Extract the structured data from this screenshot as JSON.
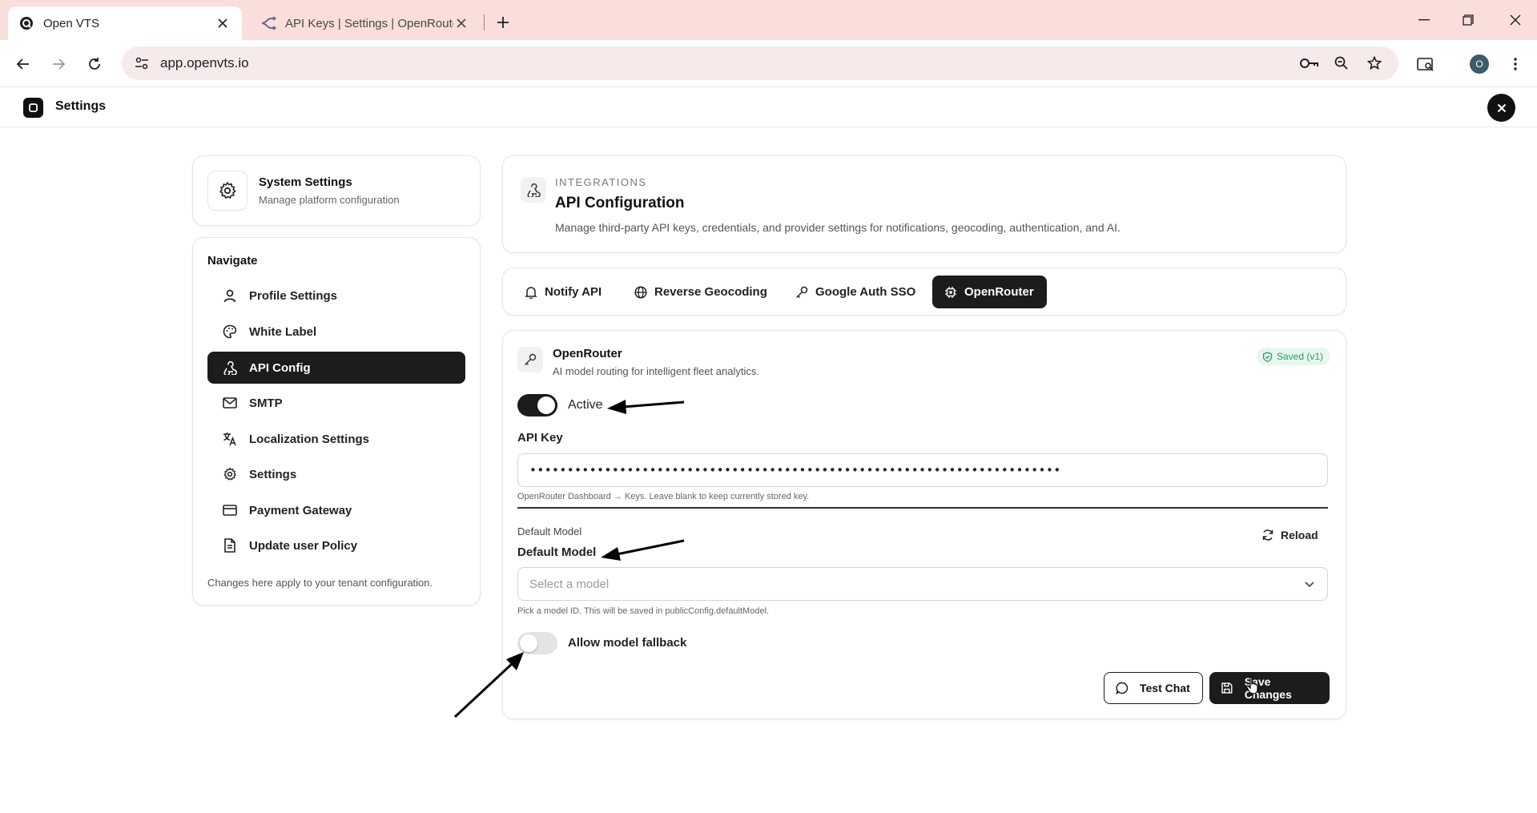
{
  "browser": {
    "tabs": [
      {
        "title": "Open VTS",
        "active": true,
        "icon": "openvts-favicon-icon"
      },
      {
        "title": "API Keys | Settings | OpenRoute",
        "active": false,
        "icon": "openrouter-favicon-icon"
      }
    ],
    "url": "app.openvts.io",
    "profile_initial": "O"
  },
  "app": {
    "title": "Settings"
  },
  "sidebar": {
    "system_title": "System Settings",
    "system_subtitle": "Manage platform configuration",
    "nav_heading": "Navigate",
    "items": [
      {
        "label": "Profile Settings",
        "icon": "user-icon",
        "active": false
      },
      {
        "label": "White Label",
        "icon": "palette-icon",
        "active": false
      },
      {
        "label": "API Config",
        "icon": "webhook-icon",
        "active": true
      },
      {
        "label": "SMTP",
        "icon": "mail-icon",
        "active": false
      },
      {
        "label": "Localization Settings",
        "icon": "languages-icon",
        "active": false
      },
      {
        "label": "Settings",
        "icon": "gear-icon",
        "active": false
      },
      {
        "label": "Payment Gateway",
        "icon": "credit-card-icon",
        "active": false
      },
      {
        "label": "Update user Policy",
        "icon": "document-icon",
        "active": false
      }
    ],
    "footer_note": "Changes here apply to your tenant configuration."
  },
  "integrations": {
    "kicker": "INTEGRATIONS",
    "title": "API Configuration",
    "description": "Manage third-party API keys, credentials, and provider settings for notifications, geocoding, authentication, and AI."
  },
  "api_tabs": [
    {
      "label": "Notify API",
      "icon": "bell-icon",
      "active": false
    },
    {
      "label": "Reverse Geocoding",
      "icon": "globe-icon",
      "active": false
    },
    {
      "label": "Google Auth SSO",
      "icon": "key-icon",
      "active": false
    },
    {
      "label": "OpenRouter",
      "icon": "cpu-icon",
      "active": true
    }
  ],
  "openrouter": {
    "title": "OpenRouter",
    "subtitle": "AI model routing for intelligent fleet analytics.",
    "badge": "Saved (v1)",
    "active_label": "Active",
    "active_on": true,
    "api_key_label": "API Key",
    "api_key_value": "•••••••••••••••••••••••••••••••••••••••••••••••••••••••••••••••••••••••",
    "api_key_hint": "OpenRouter Dashboard → Keys. Leave blank to keep currently stored key.",
    "default_model_small": "Default Model",
    "reload_label": "Reload",
    "default_model_label": "Default Model",
    "model_placeholder": "Select a model",
    "model_hint": "Pick a model ID. This will be saved in publicConfig.defaultModel.",
    "fallback_label": "Allow model fallback",
    "fallback_on": false,
    "test_chat_label": "Test Chat",
    "save_label": "Save Changes"
  },
  "colors": {
    "tabbar_bg": "#f9dedb",
    "omnibox_bg": "#f6ebea",
    "primary_dark": "#1c1c1e",
    "badge_green": "#2b9a6a",
    "badge_bg": "#e7f7ef"
  }
}
